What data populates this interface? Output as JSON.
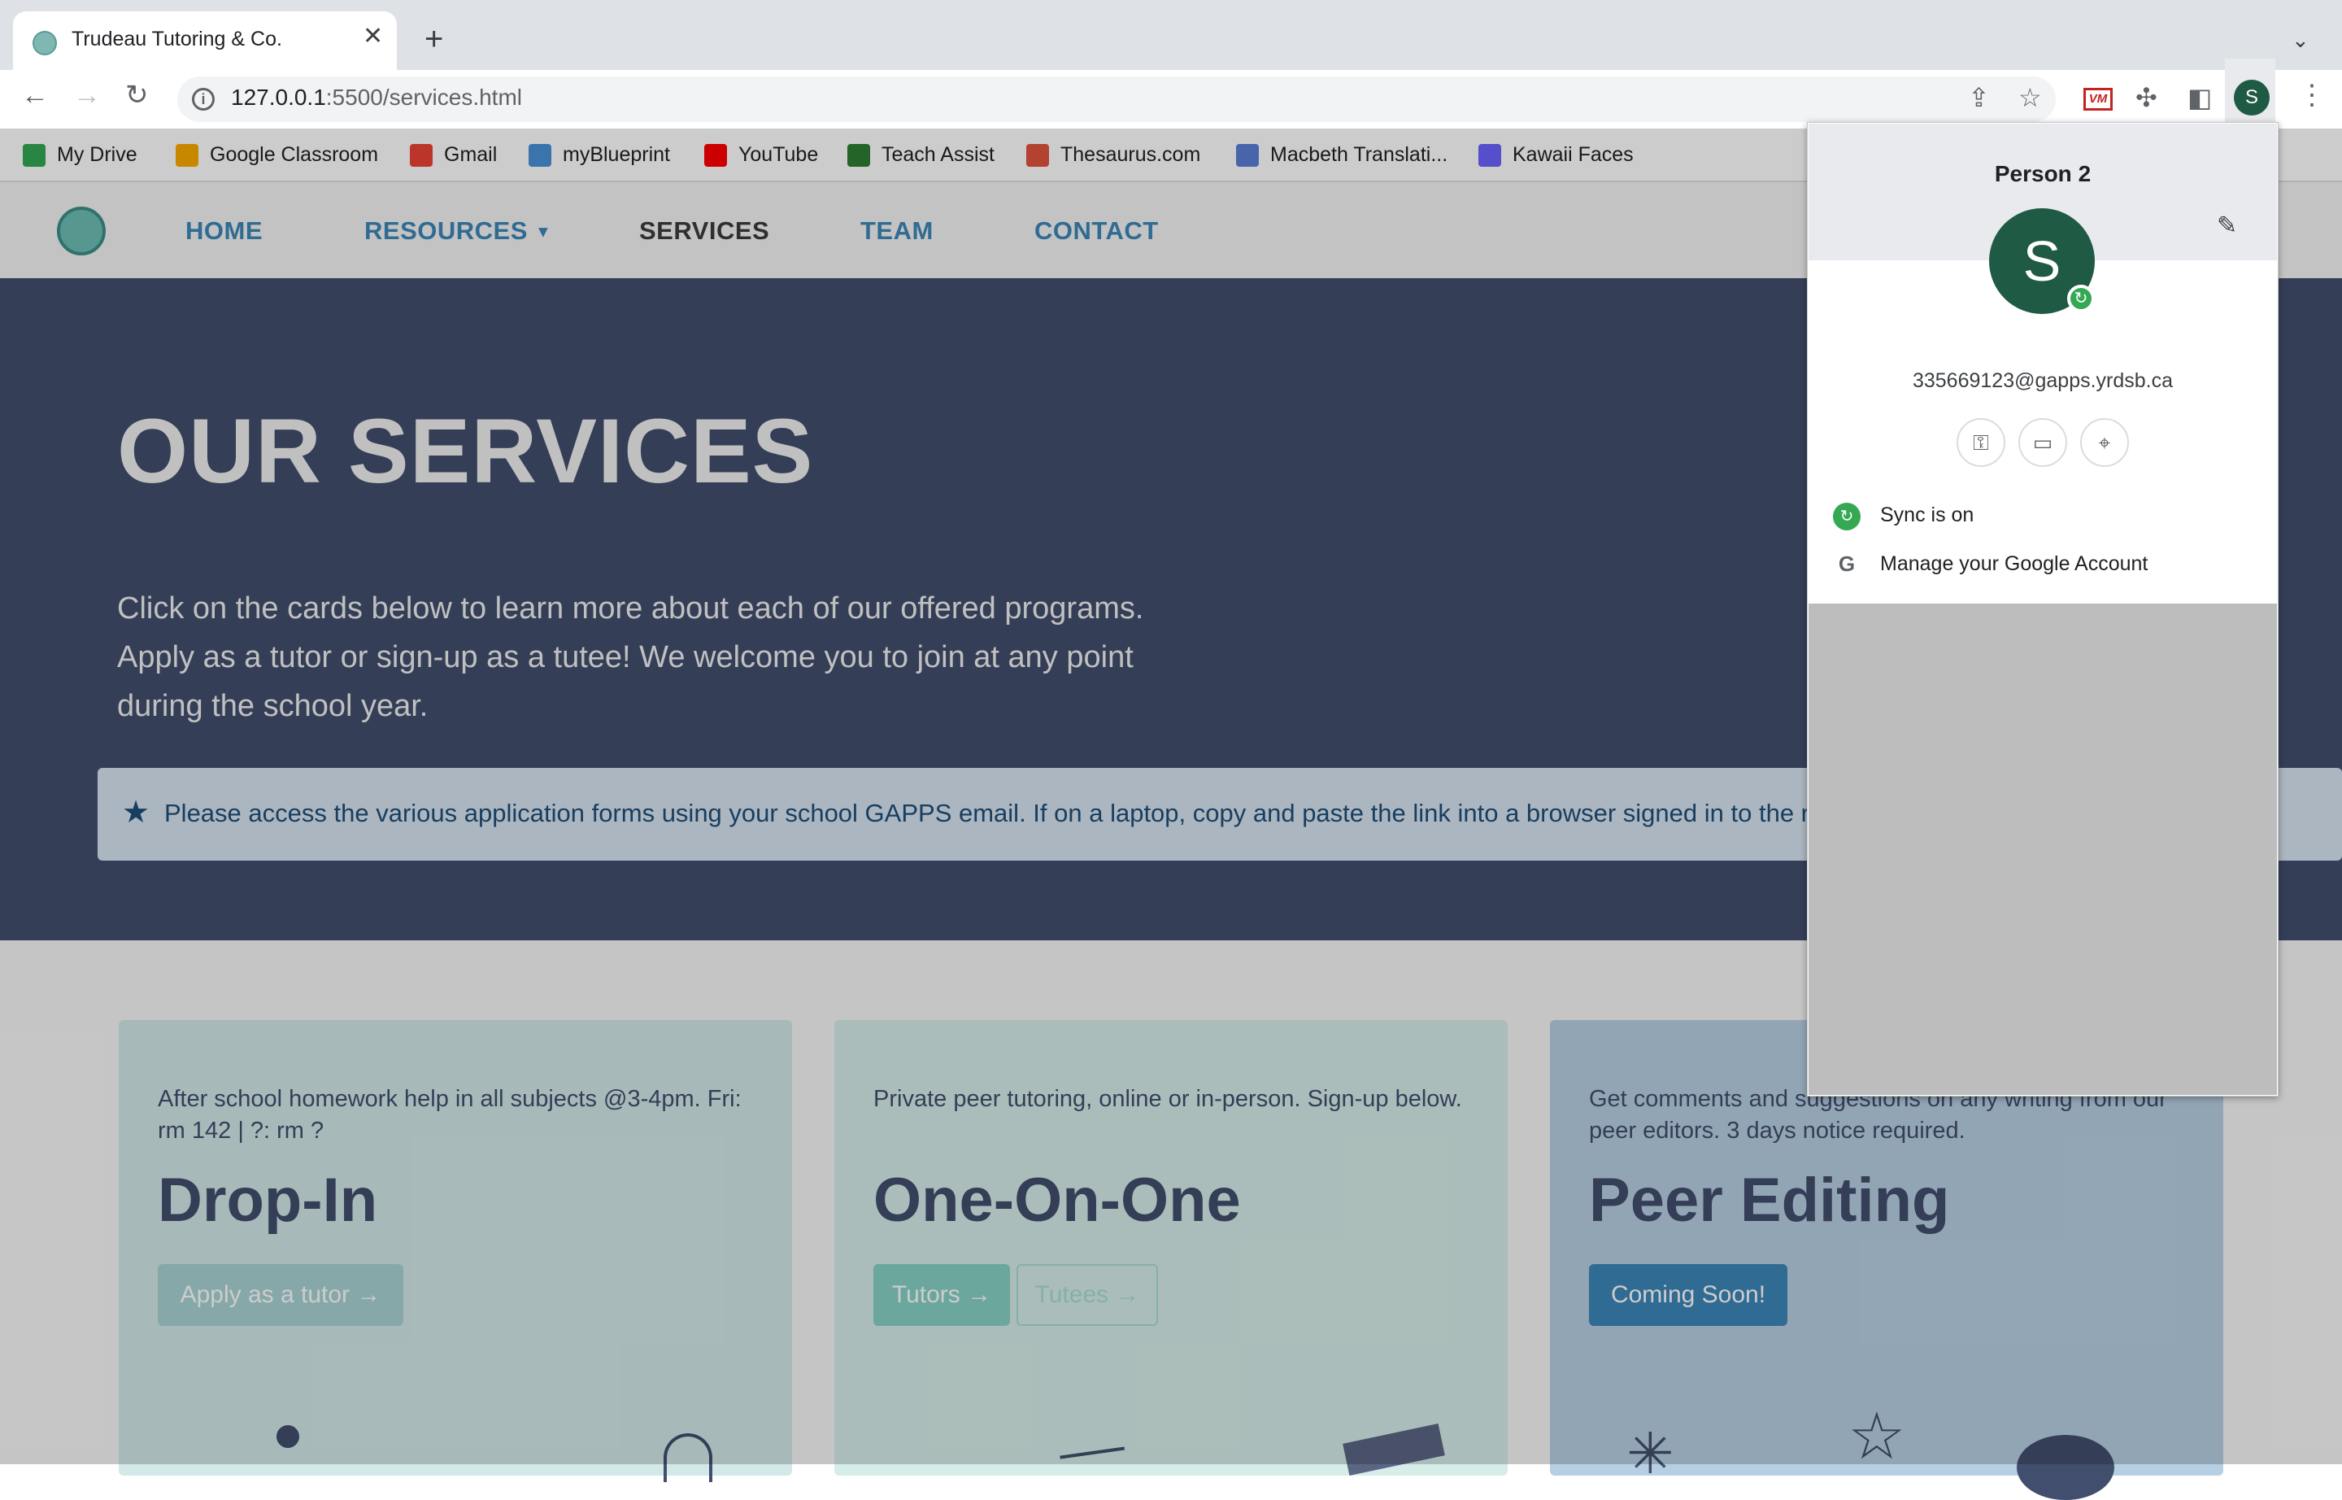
{
  "browser": {
    "tab_title": "Trudeau Tutoring & Co.",
    "url_host": "127.0.0.1",
    "url_rest": ":5500/services.html",
    "profile_initial": "S",
    "bookmarks": [
      {
        "label": "My Drive",
        "color": "#34a853"
      },
      {
        "label": "Google Classroom",
        "color": "#f9ab00"
      },
      {
        "label": "Gmail",
        "color": "#ea4335"
      },
      {
        "label": "myBlueprint",
        "color": "#4a90d9"
      },
      {
        "label": "YouTube",
        "color": "#ff0000"
      },
      {
        "label": "Teach Assist",
        "color": "#2e7d32"
      },
      {
        "label": "Thesaurus.com",
        "color": "#e0533d"
      },
      {
        "label": "Macbeth Translati...",
        "color": "#5b7fd6"
      },
      {
        "label": "Kawaii Faces",
        "color": "#6c63ff"
      }
    ]
  },
  "site": {
    "nav": {
      "home": "HOME",
      "resources": "RESOURCES",
      "services": "SERVICES",
      "team": "TEAM",
      "contact": "CONTACT"
    },
    "hero": {
      "title": "OUR SERVICES",
      "text": "Click on the cards below to learn more about each of our offered programs. Apply as a tutor or sign-up as a tutee! We welcome you to join at any point during the school year.",
      "alert": "Please access the various application forms using your school GAPPS email. If on a laptop, copy and paste the link into a browser signed in to the right a"
    },
    "cards": [
      {
        "desc": "After school homework help in all subjects @3-4pm. Fri: rm 142 | ?: rm ?",
        "title": "Drop-In",
        "buttons": [
          "Apply as a tutor →"
        ]
      },
      {
        "desc": "Private peer tutoring, online or in-person. Sign-up below.",
        "title": "One-On-One",
        "buttons": [
          "Tutors →",
          "Tutees →"
        ]
      },
      {
        "desc": "Get comments and suggestions on any writing from our peer editors. 3 days notice required.",
        "title": "Peer Editing",
        "buttons": [
          "Coming Soon!"
        ]
      }
    ]
  },
  "profile_popup": {
    "name": "Person 2",
    "initial": "S",
    "email": "335669123@gapps.yrdsb.ca",
    "sync": "Sync is on",
    "manage": "Manage your Google Account"
  },
  "colors": {
    "hero_bg": "#424e6d",
    "nav_link": "#3d86b8",
    "avatar": "#1f5a44"
  }
}
